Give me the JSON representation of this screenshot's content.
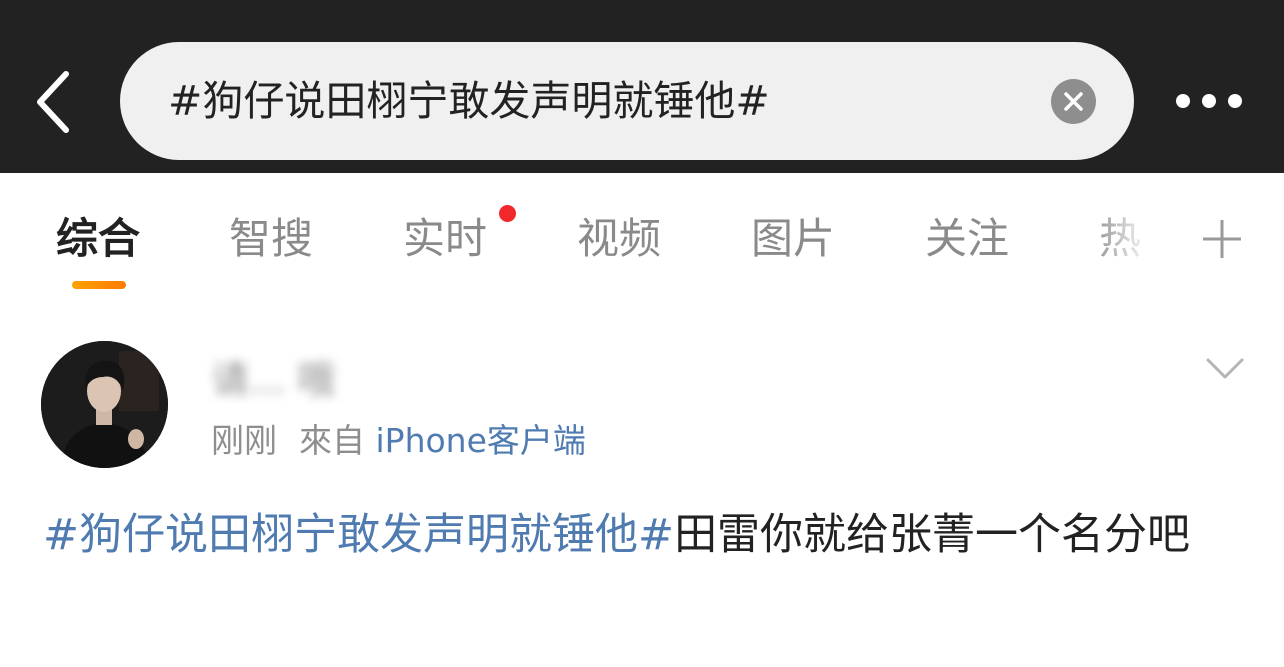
{
  "search": {
    "query": "#狗仔说田栩宁敢发声明就锤他#"
  },
  "tabs": [
    {
      "label": "综合",
      "active": true
    },
    {
      "label": "智搜"
    },
    {
      "label": "实时",
      "has_red_dot": true
    },
    {
      "label": "视频"
    },
    {
      "label": "图片"
    },
    {
      "label": "关注"
    },
    {
      "label": "热"
    }
  ],
  "post": {
    "username": "请... 哦",
    "time": "刚刚",
    "from_prefix": "來自",
    "source": "iPhone客户端",
    "hashtag": "#狗仔说田栩宁敢发声明就锤他#",
    "text": "田雷你就给张菁一个名分吧"
  },
  "colors": {
    "topbar_bg": "#222222",
    "search_bg": "#f0f0f0",
    "link_blue": "#4f7bb0",
    "accent_orange": "#ff8c00",
    "red_dot": "#f0282c"
  }
}
